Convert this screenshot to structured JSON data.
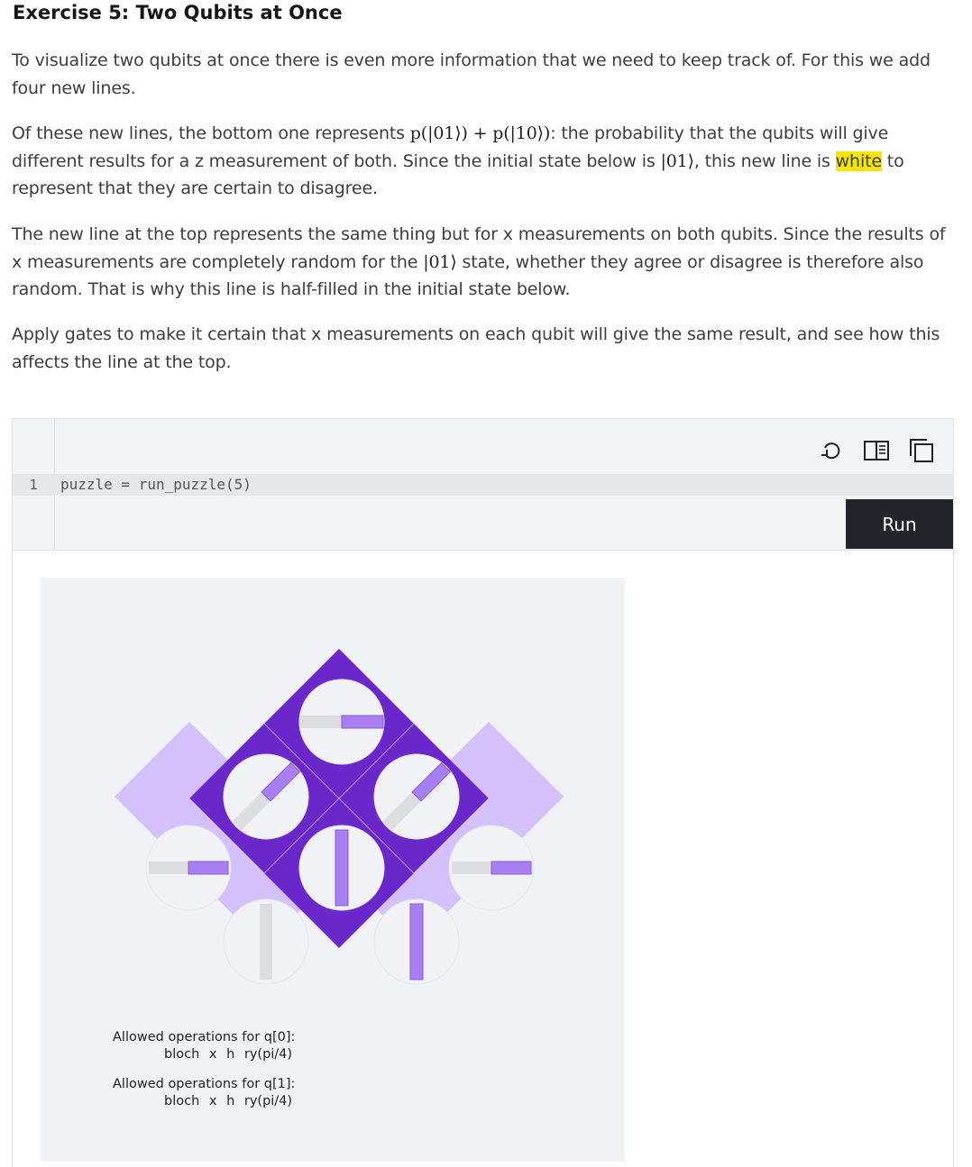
{
  "heading": "Exercise 5: Two Qubits at Once",
  "p1": "To visualize two qubits at once there is even more information that we need to keep track of. For this we add four new lines.",
  "p2": {
    "t1": "Of these new lines, the bottom one represents ",
    "math1": "p(|01⟩) + p(|10⟩)",
    "t2": ": the probability that the qubits will give different results for a z measurement of both. Since the initial state below is ",
    "math2": "|01⟩",
    "t3": ", this new line is ",
    "highlight": "white",
    "t4": " to represent that they are certain to disagree."
  },
  "p3": {
    "t1": "The new line at the top represents the same thing but for x measurements on both qubits. Since the results of x measurements are completely random for the ",
    "math": "|01⟩",
    "t2": " state, whether they agree or disagree is therefore also random. That is why this line is half-filled in the initial state below."
  },
  "p4": "Apply gates to make it certain that x measurements on each qubit will give the same result, and see how this affects the line at the top.",
  "cell": {
    "line_number": "1",
    "code": "puzzle = run_puzzle(5)",
    "run_label": "Run",
    "toolbar_icons": [
      "undo-icon",
      "split-view-icon",
      "copy-icon"
    ]
  },
  "output": {
    "ops_q0_title": "Allowed operations for q[0]:",
    "ops_q0_list": "bloch x h ry(pi/4)",
    "ops_q1_title": "Allowed operations for q[1]:",
    "ops_q1_list": "bloch x h ry(pi/4)"
  },
  "colors": {
    "dark_purple": "#6a27c9",
    "light_purple": "#d4c0fa",
    "bar_fill": "#a87ff0",
    "bar_empty": "#dcdde0",
    "highlight": "#f7e500",
    "run_button": "#22262a"
  }
}
